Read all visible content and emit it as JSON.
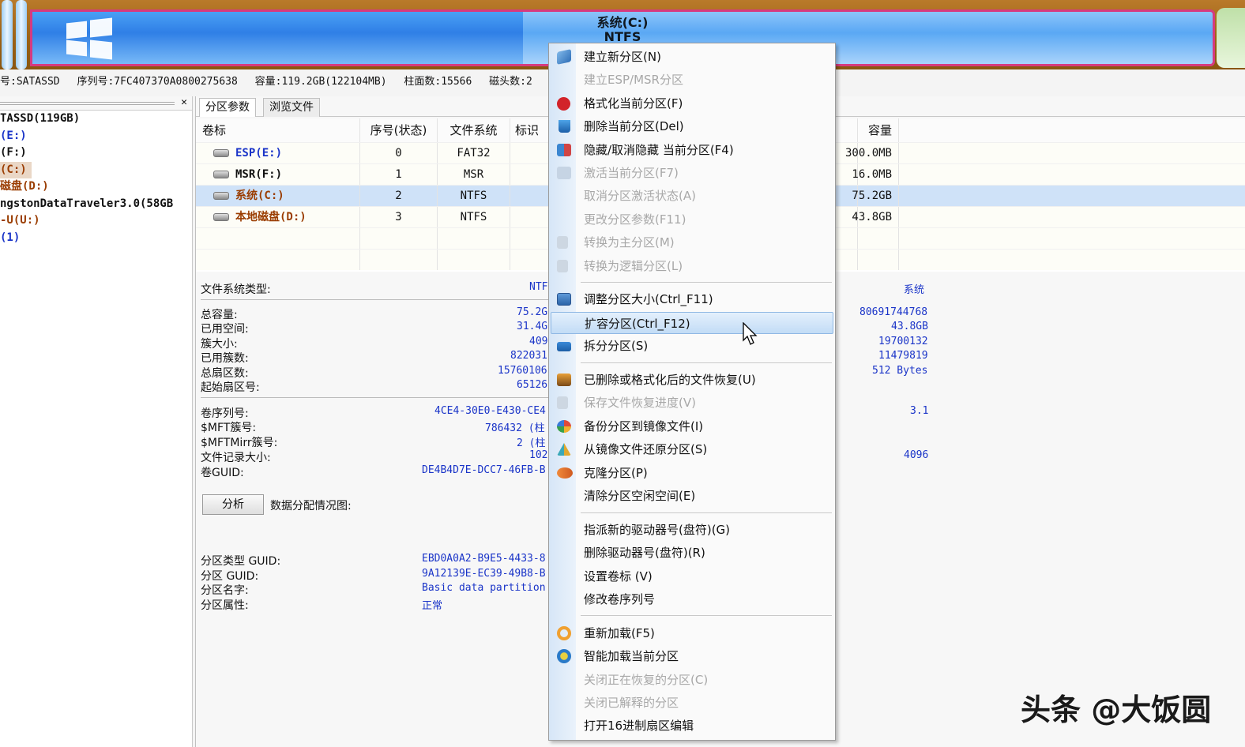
{
  "disk_map": {
    "partition_title": "系统(C:)",
    "partition_fs": "NTFS",
    "colors": {
      "border": "#d63a7f",
      "partition": "#2f7fe6",
      "unallocated": "#9a6014"
    }
  },
  "disk_info": {
    "model": "号:SATASSD",
    "serial": "序列号:7FC407370A0800275638",
    "capacity": "容量:119.2GB(122104MB)",
    "cylinders": "柱面数:15566",
    "heads": "磁头数:2"
  },
  "tree": {
    "items": [
      "TASSD(119GB)",
      "(E:)",
      "(F:)",
      "(C:)",
      "磁盘(D:)",
      "ngstonDataTraveler3.0(58GB",
      "-U(U:)",
      "(1)"
    ]
  },
  "tabs": [
    {
      "label": "分区参数"
    },
    {
      "label": "浏览文件"
    }
  ],
  "grid": {
    "headers": {
      "volume": "卷标",
      "index": "序号(状态)",
      "fs": "文件系统",
      "flag": "标识",
      "capacity": "容量"
    },
    "rows": [
      {
        "volume": "ESP(E:)",
        "index": "0",
        "fs": "FAT32",
        "capacity": "300.0MB"
      },
      {
        "volume": "MSR(F:)",
        "index": "1",
        "fs": "MSR",
        "capacity": "16.0MB"
      },
      {
        "volume": "系统(C:)",
        "index": "2",
        "fs": "NTFS",
        "capacity": "75.2GB"
      },
      {
        "volume": "本地磁盘(D:)",
        "index": "3",
        "fs": "NTFS",
        "capacity": "43.8GB"
      }
    ]
  },
  "props": {
    "fs_type": {
      "label": "文件系统类型:",
      "value": "NTF",
      "right": "系统"
    },
    "total_cap": {
      "label": "总容量:",
      "value": "75.2G",
      "right": "80691744768"
    },
    "used": {
      "label": "已用空间:",
      "value": "31.4G",
      "right": "43.8GB"
    },
    "cluster_size": {
      "label": "簇大小:",
      "value": "409",
      "right": "19700132"
    },
    "used_clusters": {
      "label": "已用簇数:",
      "value": "822031",
      "right": "11479819"
    },
    "total_sectors": {
      "label": "总扇区数:",
      "value": "15760106",
      "right": "512 Bytes"
    },
    "start_sector": {
      "label": "起始扇区号:",
      "value": "65126"
    },
    "vol_serial": {
      "label": "卷序列号:",
      "value": "4CE4-30E0-E430-CE4",
      "right": "3.1"
    },
    "mft": {
      "label": "$MFT簇号:",
      "value": "786432 (柱"
    },
    "mftmirr": {
      "label": "$MFTMirr簇号:",
      "value": "2 (柱"
    },
    "record_size": {
      "label": "文件记录大小:",
      "value": "102",
      "right": "4096"
    },
    "vol_guid": {
      "label": "卷GUID:",
      "value": "DE4B4D7E-DCC7-46FB-B"
    },
    "analyze_button": "分析",
    "alloc_label": "数据分配情况图:",
    "type_guid": {
      "label": "分区类型 GUID:",
      "value": "EBD0A0A2-B9E5-4433-8"
    },
    "part_guid": {
      "label": "分区 GUID:",
      "value": "9A12139E-EC39-49B8-B"
    },
    "part_name": {
      "label": "分区名字:",
      "value": "Basic data partition"
    },
    "part_attr": {
      "label": "分区属性:",
      "value": "正常"
    }
  },
  "menu": {
    "items": [
      {
        "label": "建立新分区(N)",
        "icon": "layers-icon",
        "disabled": false
      },
      {
        "label": "建立ESP/MSR分区",
        "icon": "",
        "disabled": true
      },
      {
        "label": "格式化当前分区(F)",
        "icon": "format-icon",
        "disabled": false
      },
      {
        "label": "删除当前分区(Del)",
        "icon": "trash-icon",
        "disabled": false
      },
      {
        "label": "隐藏/取消隐藏 当前分区(F4)",
        "icon": "hide-icon",
        "disabled": false
      },
      {
        "label": "激活当前分区(F7)",
        "icon": "activate-icon",
        "disabled": true
      },
      {
        "label": "取消分区激活状态(A)",
        "icon": "",
        "disabled": true
      },
      {
        "label": "更改分区参数(F11)",
        "icon": "",
        "disabled": true
      },
      {
        "label": "转换为主分区(M)",
        "icon": "convert-primary-icon",
        "disabled": true
      },
      {
        "label": "转换为逻辑分区(L)",
        "icon": "convert-logical-icon",
        "disabled": true
      },
      {
        "label": "调整分区大小(Ctrl_F11)",
        "icon": "resize-icon",
        "disabled": false
      },
      {
        "label": "扩容分区(Ctrl_F12)",
        "icon": "",
        "disabled": false,
        "highlighted": true
      },
      {
        "label": "拆分分区(S)",
        "icon": "split-icon",
        "disabled": false
      },
      {
        "label": "已删除或格式化后的文件恢复(U)",
        "icon": "recover-icon",
        "disabled": false
      },
      {
        "label": "保存文件恢复进度(V)",
        "icon": "save-progress-icon",
        "disabled": true
      },
      {
        "label": "备份分区到镜像文件(I)",
        "icon": "backup-icon",
        "disabled": false
      },
      {
        "label": "从镜像文件还原分区(S)",
        "icon": "restore-icon",
        "disabled": false
      },
      {
        "label": "克隆分区(P)",
        "icon": "clone-icon",
        "disabled": false
      },
      {
        "label": "清除分区空闲空间(E)",
        "icon": "",
        "disabled": false
      },
      {
        "label": "指派新的驱动器号(盘符)(G)",
        "icon": "",
        "disabled": false
      },
      {
        "label": "删除驱动器号(盘符)(R)",
        "icon": "",
        "disabled": false
      },
      {
        "label": "设置卷标 (V)",
        "icon": "",
        "disabled": false
      },
      {
        "label": "修改卷序列号",
        "icon": "",
        "disabled": false
      },
      {
        "label": "重新加载(F5)",
        "icon": "reload-icon",
        "disabled": false
      },
      {
        "label": "智能加载当前分区",
        "icon": "smart-load-icon",
        "disabled": false
      },
      {
        "label": "关闭正在恢复的分区(C)",
        "icon": "",
        "disabled": true
      },
      {
        "label": "关闭已解释的分区",
        "icon": "",
        "disabled": true
      },
      {
        "label": "打开16进制扇区编辑",
        "icon": "",
        "disabled": false
      }
    ]
  },
  "watermark": "头条 @大饭圆"
}
